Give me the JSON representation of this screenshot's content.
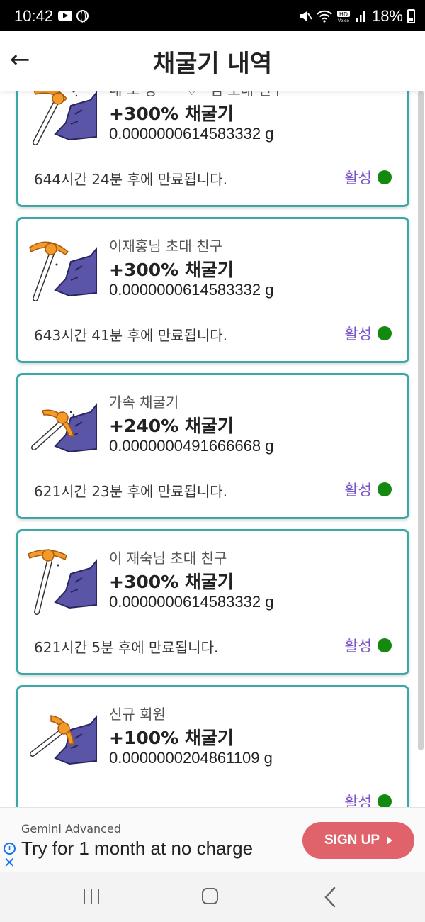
{
  "status_bar": {
    "time": "10:42",
    "battery": "18%",
    "icons": [
      "youtube-icon",
      "globe-icon",
      "mute-icon",
      "wifi-icon",
      "hd-voice-icon",
      "signal-icon",
      "battery-icon"
    ]
  },
  "header": {
    "back_icon": "←",
    "title": "채굴기 내역"
  },
  "colors": {
    "card_border": "#3aa9a6",
    "status_text": "#7a56c9",
    "status_dot": "#13890f",
    "ad_button": "#e0636b"
  },
  "cards": [
    {
      "title": "내 꼬 양 ~^♡^님 초대 친구",
      "rate": "+300% 채굴기",
      "amount": "0.0000000614583332 g",
      "expire": "644시간 24분 후에 만료됩니다.",
      "status": "활성"
    },
    {
      "title": "이재홍님 초대 친구",
      "rate": "+300% 채굴기",
      "amount": "0.0000000614583332 g",
      "expire": "643시간 41분 후에 만료됩니다.",
      "status": "활성"
    },
    {
      "title": "가속 채굴기",
      "rate": "+240% 채굴기",
      "amount": "0.0000000491666668 g",
      "expire": "621시간 23분 후에 만료됩니다.",
      "status": "활성"
    },
    {
      "title": "이 재숙님 초대 친구",
      "rate": "+300% 채굴기",
      "amount": "0.0000000614583332 g",
      "expire": "621시간 5분 후에 만료됩니다.",
      "status": "활성"
    },
    {
      "title": "신규 회원",
      "rate": "+100% 채굴기",
      "amount": "0.0000000204861109 g",
      "expire": "",
      "status": "활성"
    }
  ],
  "ad": {
    "advertiser": "Gemini Advanced",
    "headline": "Try for 1 month at no charge",
    "cta": "SIGN UP",
    "info_icon": "i",
    "close_icon": "✕"
  }
}
